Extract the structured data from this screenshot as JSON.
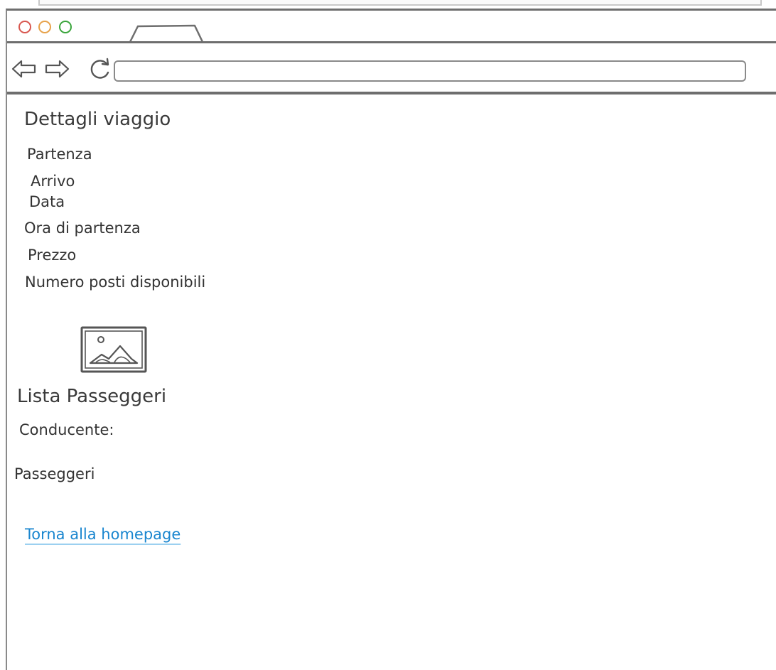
{
  "browser": {
    "address_value": ""
  },
  "trip": {
    "title": "Dettagli viaggio",
    "fields": {
      "partenza": "Partenza",
      "arrivo": "Arrivo",
      "data": "Data",
      "ora_partenza": "Ora di partenza",
      "prezzo": "Prezzo",
      "posti": "Numero posti disponibili"
    }
  },
  "passengers": {
    "title": "Lista Passeggeri",
    "driver_label": "Conducente:",
    "passengers_label": "Passeggeri"
  },
  "footer": {
    "home_link": "Torna alla homepage"
  },
  "colors": {
    "link": "#1a86cf",
    "close": "#d8574f",
    "minimize": "#e7a24a",
    "maximize": "#3aa53c"
  }
}
